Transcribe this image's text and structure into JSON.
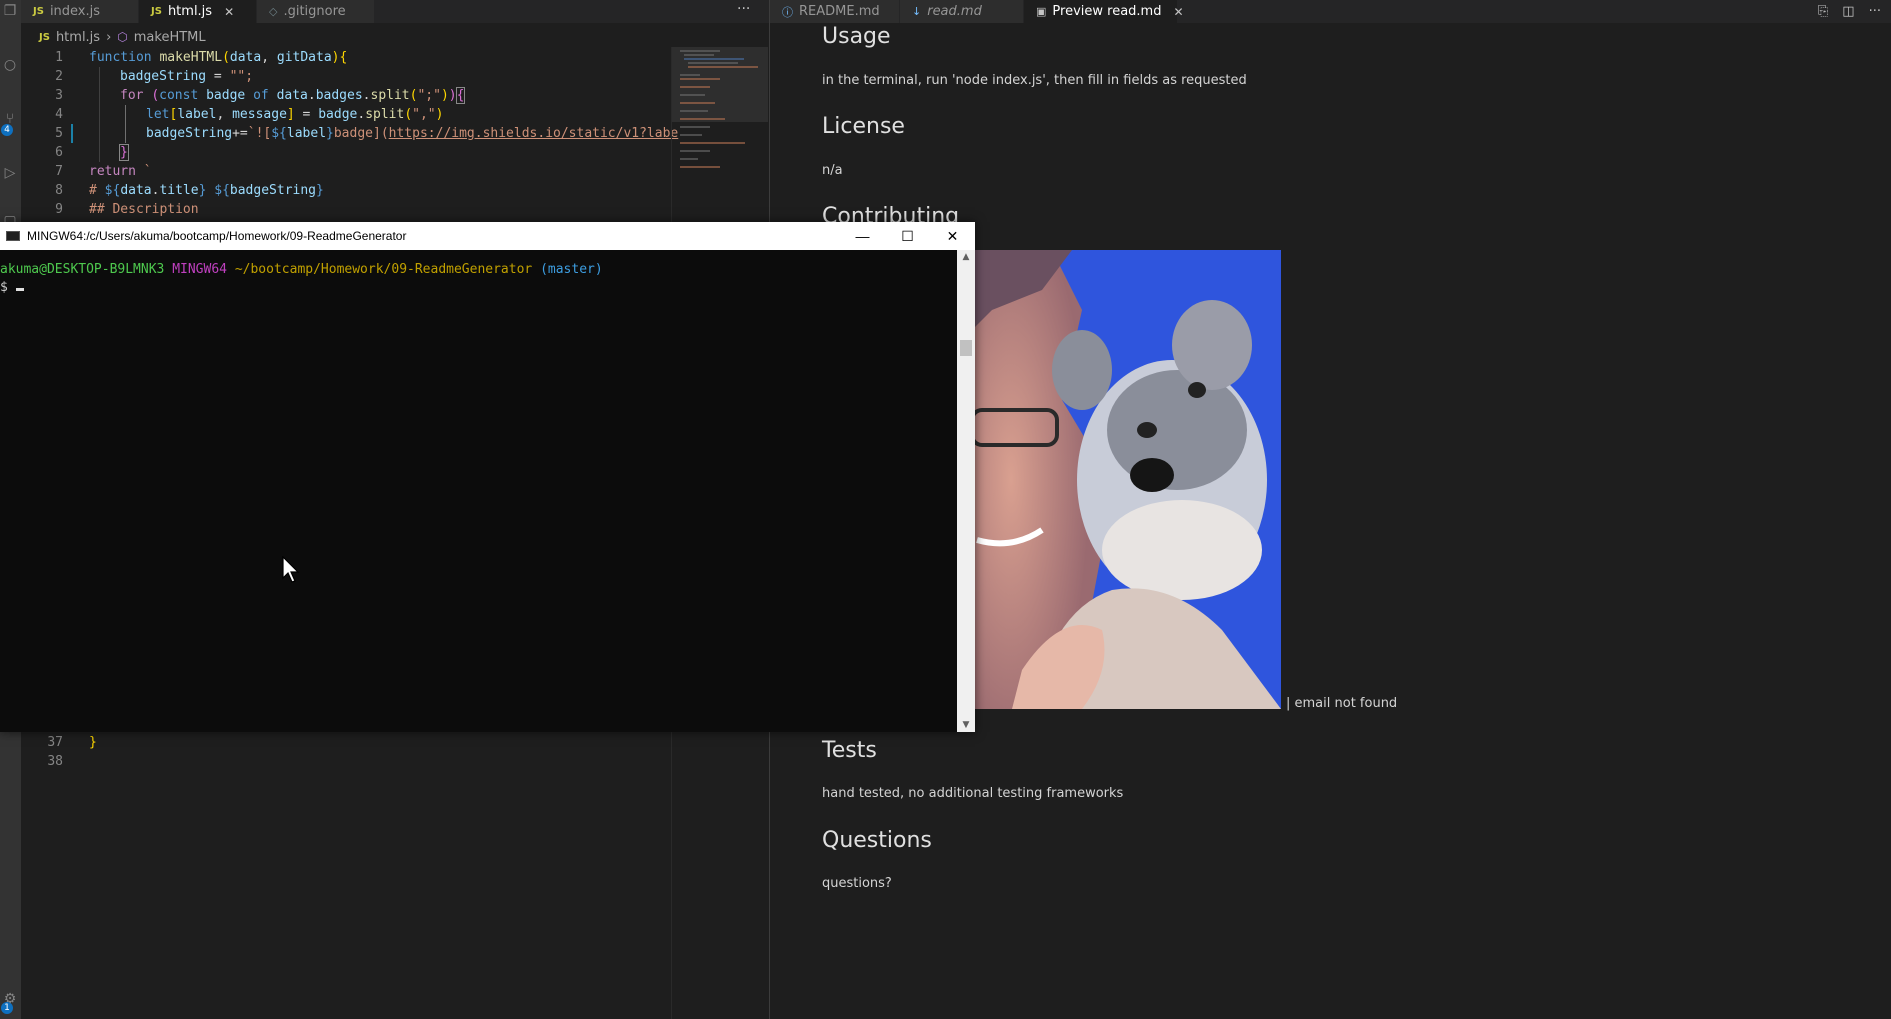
{
  "activity_bar": {
    "scm_badge": "4",
    "accounts_badge": "1"
  },
  "left_editor": {
    "tabs": [
      {
        "icon": "JS",
        "label": "index.js",
        "active": false
      },
      {
        "icon": "JS",
        "label": "html.js",
        "active": true
      },
      {
        "icon": "◇",
        "label": ".gitignore",
        "active": false
      }
    ],
    "more_actions": "···",
    "breadcrumb": {
      "file": "html.js",
      "symbol": "makeHTML"
    },
    "line_numbers_top": [
      "1",
      "2",
      "3",
      "4",
      "5",
      "6",
      "7",
      "8",
      "9"
    ],
    "line_numbers_bottom": [
      "37",
      "38"
    ],
    "code_bottom": [
      "}",
      ""
    ]
  },
  "right_editor": {
    "tabs": [
      {
        "icon": "ⓘ",
        "label": "README.md",
        "active": false,
        "italic": false
      },
      {
        "icon": "↓",
        "label": "read.md",
        "active": false,
        "italic": true
      },
      {
        "icon": "▣",
        "label": "Preview read.md",
        "active": true,
        "italic": false
      }
    ],
    "preview": {
      "usage_heading": "Usage",
      "usage_text": "in the terminal, run 'node index.js', then fill in fields as requested",
      "license_heading": "License",
      "license_text": "n/a",
      "contributing_heading": "Contributing",
      "email_text": "| email not found",
      "tests_heading": "Tests",
      "tests_text": "hand tested, no additional testing frameworks",
      "questions_heading": "Questions",
      "questions_text": "questions?"
    }
  },
  "terminal": {
    "title": "MINGW64:/c/Users/akuma/bootcamp/Homework/09-ReadmeGenerator",
    "prompt_user": "akuma@DESKTOP-B9LMNK3",
    "prompt_shell": "MINGW64",
    "prompt_path": "~/bootcamp/Homework/09-ReadmeGenerator",
    "prompt_branch": "(master)",
    "prompt_symbol": "$",
    "minimize": "—",
    "maximize": "☐",
    "close": "✕"
  }
}
